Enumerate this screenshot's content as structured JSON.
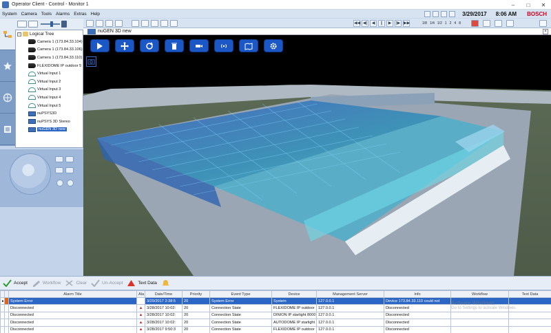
{
  "window": {
    "title": "Operator Client - Control - Monitor 1"
  },
  "menu": [
    "System",
    "Camera",
    "Tools",
    "Alarms",
    "Extras",
    "Help"
  ],
  "status": {
    "date": "3/29/2017",
    "time": "8:06 AM",
    "brand": "BOSCH"
  },
  "tree": {
    "root": "Logical Tree",
    "items": [
      {
        "label": "Camera 1 (173.84.33.104)",
        "icon": "camera-icon"
      },
      {
        "label": "Camera 1 (173.84.33.106)",
        "icon": "camera-icon"
      },
      {
        "label": "Camera 1 (173.84.33.110)",
        "icon": "camera-icon"
      },
      {
        "label": "FLEXIDOME IP outdoor 5",
        "icon": "camera-icon"
      },
      {
        "label": "Virtual Input 1",
        "icon": "virtual-input-icon"
      },
      {
        "label": "Virtual Input 2",
        "icon": "virtual-input-icon"
      },
      {
        "label": "Virtual Input 3",
        "icon": "virtual-input-icon"
      },
      {
        "label": "Virtual Input 4",
        "icon": "virtual-input-icon"
      },
      {
        "label": "Virtual Input 5",
        "icon": "virtual-input-icon"
      },
      {
        "label": "nuPSYS3D",
        "icon": "map-icon"
      },
      {
        "label": "nuPSYS 3D Stereo",
        "icon": "map-icon"
      },
      {
        "label": "nuGEN 3D new",
        "icon": "map-icon",
        "selected": true
      }
    ]
  },
  "playback": {
    "speeds": [
      "1/8",
      "1/4",
      "1/2",
      "1",
      "2",
      "4",
      "8"
    ]
  },
  "viewer": {
    "title": "nuGEN 3D new",
    "buttons": [
      "select-icon",
      "move-icon",
      "rotate-icon",
      "delete-icon",
      "camera-view-icon",
      "broadcast-icon",
      "map-layer-icon",
      "settings-icon"
    ]
  },
  "alarmbar": {
    "accept": "Accept",
    "workflow": "Workflow",
    "clear": "Clear",
    "unaccept": "Un-Accept",
    "textdata": "Text Data"
  },
  "table": {
    "headers": [
      "Alarm Title",
      "Ala",
      "Date/Time",
      "Priority",
      "Event Type",
      "Device",
      "Management Server",
      "Info",
      "Workflow",
      "Text Data"
    ],
    "rows": [
      {
        "title": "System Error",
        "datetime": "3/29/2017 2:38:5",
        "priority": "20",
        "event": "System Error",
        "device": "System",
        "server": "127.0.0.1",
        "info": "Device 173.84.33.110 could not",
        "selected": true
      },
      {
        "title": "Disconnected",
        "datetime": "3/28/2017 10:02:",
        "priority": "20",
        "event": "Connection State",
        "device": "FLEXIDOME IP outdoor",
        "server": "127.0.0.1",
        "info": "Disconnected"
      },
      {
        "title": "Disconnected",
        "datetime": "3/28/2017 10:02:",
        "priority": "20",
        "event": "Connection State",
        "device": "DINION IP starlight 8000",
        "server": "127.0.0.1",
        "info": "Disconnected"
      },
      {
        "title": "Disconnected",
        "datetime": "3/28/2017 10:02:",
        "priority": "20",
        "event": "Connection State",
        "device": "AUTODOME IP starlight",
        "server": "127.0.0.1",
        "info": "Disconnected"
      },
      {
        "title": "Disconnected",
        "datetime": "3/28/2017 9:50:3",
        "priority": "20",
        "event": "Connection State",
        "device": "FLEXIDOME IP outdoor",
        "server": "127.0.0.1",
        "info": "Disconnected"
      }
    ]
  },
  "watermark": {
    "line1": "Activate Windows",
    "line2": "Go to Settings to activate Windows."
  }
}
